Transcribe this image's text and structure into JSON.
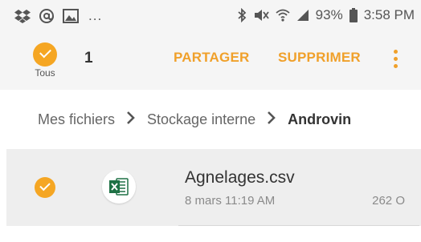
{
  "status_bar": {
    "left_icons": [
      "dropbox-icon",
      "at-icon",
      "image-icon"
    ],
    "overflow": "...",
    "battery": "93%",
    "time": "3:58 PM"
  },
  "action_bar": {
    "select_all_label": "Tous",
    "selected_count": "1",
    "share_label": "PARTAGER",
    "delete_label": "SUPPRIMER",
    "accent_color": "#f0a02a"
  },
  "breadcrumb": {
    "items": [
      "Mes fichiers",
      "Stockage interne"
    ],
    "current": "Androvin"
  },
  "files": [
    {
      "name": "Agnelages.csv",
      "date": "8 mars 11:19 AM",
      "size": "262 O",
      "icon": "excel-icon",
      "selected": true
    }
  ]
}
